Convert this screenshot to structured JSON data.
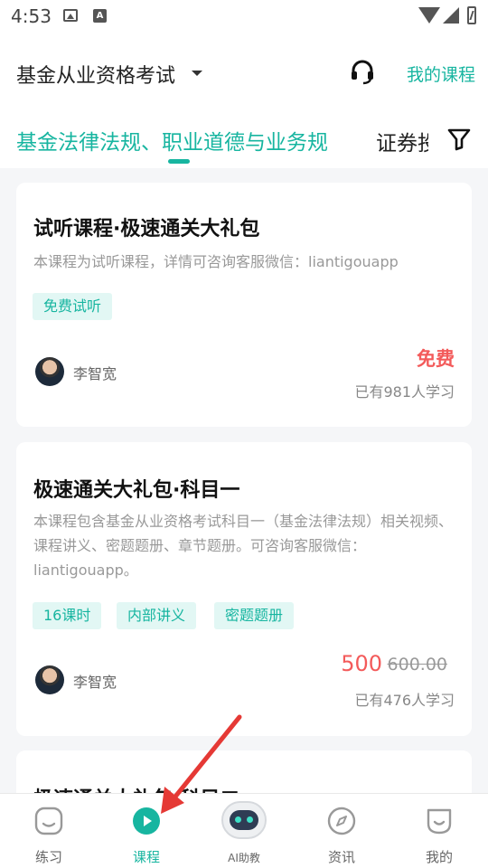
{
  "status_bar": {
    "time": "4:53"
  },
  "header": {
    "exam": "基金从业资格考试",
    "my_courses": "我的课程"
  },
  "tabs": {
    "active": "基金法律法规、职业道德与业务规",
    "next": "证券投"
  },
  "courses": [
    {
      "title": "试听课程·极速通关大礼包",
      "desc": "本课程为试听课程，详情可咨询客服微信：liantigouapp",
      "tags": [
        "免费试听"
      ],
      "teacher": "李智宽",
      "price": "免费",
      "learners": "已有981人学习"
    },
    {
      "title": "极速通关大礼包·科目一",
      "desc": "本课程包含基金从业资格考试科目一（基金法律法规）相关视频、课程讲义、密题题册、章节题册。可咨询客服微信：liantigouapp。",
      "tags": [
        "16课时",
        "内部讲义",
        "密题题册"
      ],
      "teacher": "李智宽",
      "price": "500",
      "original_price": "600.00",
      "learners": "已有476人学习"
    },
    {
      "title": "极速通关大礼包·科目二"
    }
  ],
  "bottom_nav": [
    {
      "label": "练习",
      "icon": "practice-icon"
    },
    {
      "label": "课程",
      "icon": "play-icon",
      "active": true
    },
    {
      "label": "AI助教",
      "icon": "robot-icon"
    },
    {
      "label": "资讯",
      "icon": "compass-icon"
    },
    {
      "label": "我的",
      "icon": "profile-icon"
    }
  ],
  "colors": {
    "accent": "#17b5a0",
    "price": "#f35a5a",
    "annotation_arrow": "#e53935"
  }
}
